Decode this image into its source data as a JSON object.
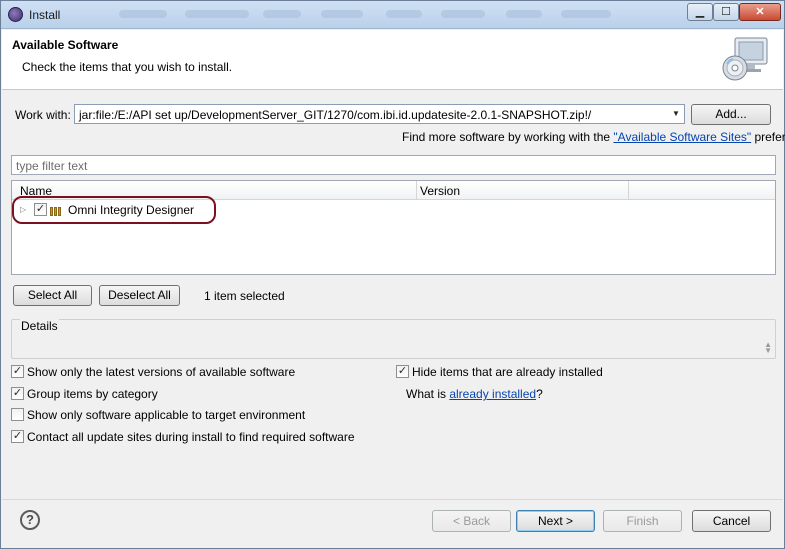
{
  "window": {
    "title": "Install",
    "controls": {
      "minimize": "▁",
      "maximize": "☐",
      "close": "✕"
    }
  },
  "banner": {
    "title": "Available Software",
    "description": "Check the items that you wish to install.",
    "icon": "install-cd-icon"
  },
  "work_with": {
    "label": "Work with:",
    "value": "jar:file:/E:/API set up/DevelopmentServer_GIT/1270/com.ibi.id.updatesite-2.0.1-SNAPSHOT.zip!/",
    "add_label": "Add...",
    "hint_prefix": "Find more software by working with the ",
    "hint_link": "\"Available Software Sites\"",
    "hint_suffix": " preferences."
  },
  "filter": {
    "placeholder": "type filter text"
  },
  "table": {
    "columns": [
      "Name",
      "Version"
    ],
    "rows": [
      {
        "name": "Omni Integrity Designer",
        "version": "",
        "checked": true
      }
    ]
  },
  "selection": {
    "select_all": "Select All",
    "deselect_all": "Deselect All",
    "status": "1 item selected"
  },
  "details": {
    "label": "Details"
  },
  "options": {
    "latest_only": {
      "label": "Show only the latest versions of available software",
      "checked": true
    },
    "group_by_category": {
      "label": "Group items by category",
      "checked": true
    },
    "target_env_only": {
      "label": "Show only software applicable to target environment",
      "checked": false
    },
    "contact_all_sites": {
      "label": "Contact all update sites during install to find required software",
      "checked": true
    },
    "hide_installed": {
      "label": "Hide items that are already installed",
      "checked": true
    },
    "what_is_prefix": "What is ",
    "what_is_link": "already installed",
    "what_is_suffix": "?"
  },
  "footer": {
    "help": "?",
    "back": "< Back",
    "next": "Next >",
    "finish": "Finish",
    "cancel": "Cancel"
  },
  "colors": {
    "link": "#0645ad",
    "highlight_ring": "#7a1020"
  }
}
